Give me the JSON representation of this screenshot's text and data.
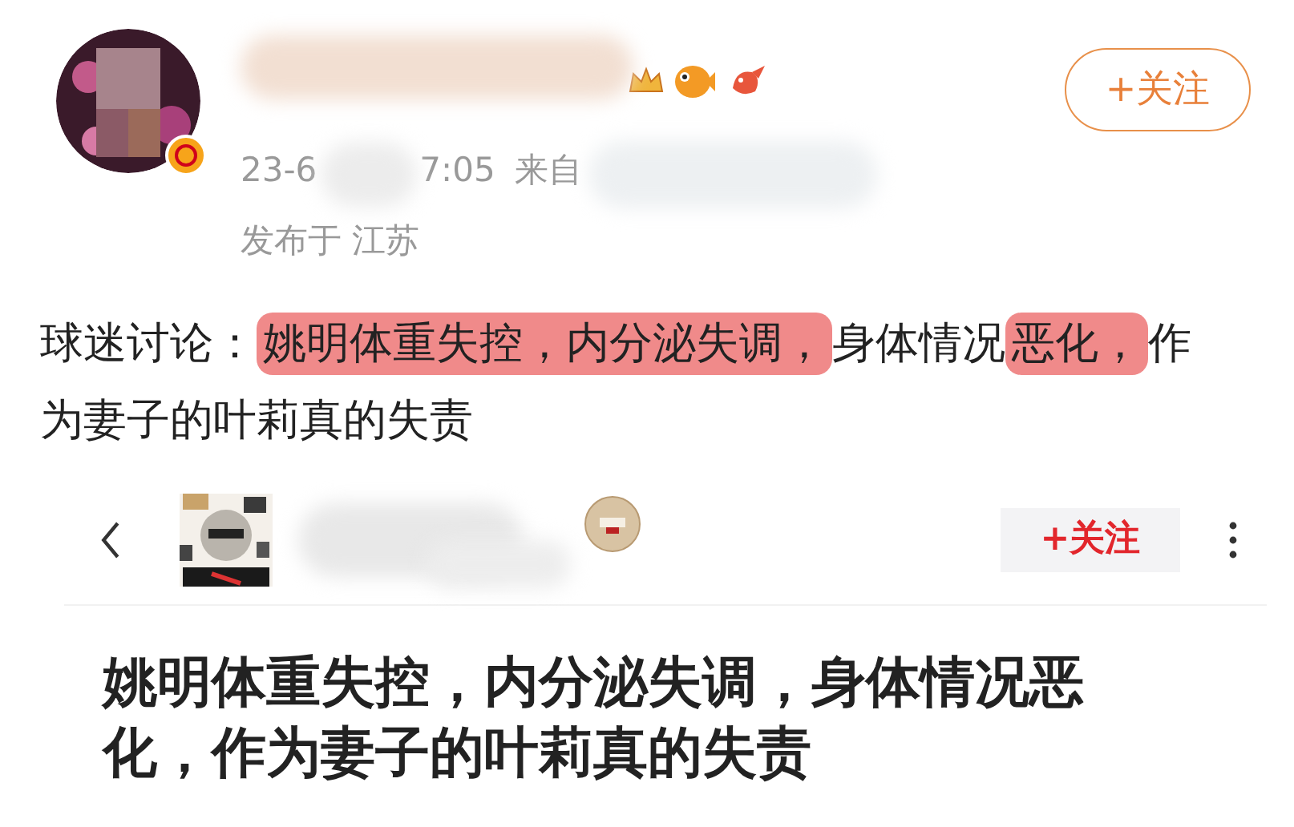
{
  "post": {
    "time_start": "23-6",
    "time_end": "7:05",
    "source_label": "来自",
    "location": "发布于 江苏",
    "follow_button": "+关注",
    "text": [
      {
        "text": "球迷讨论：",
        "highlighted": false
      },
      {
        "text": "姚明体重失控，内分泌失调，",
        "highlighted": true
      },
      {
        "text": "身体情况",
        "highlighted": false
      },
      {
        "text": "恶化，",
        "highlighted": true
      },
      {
        "text": "作为妻子的叶莉真的失责",
        "highlighted": false
      }
    ]
  },
  "embedded": {
    "follow_button": "+关注",
    "title": "姚明体重失控，内分泌失调，身体情况恶化，作为妻子的叶莉真的失责"
  }
}
